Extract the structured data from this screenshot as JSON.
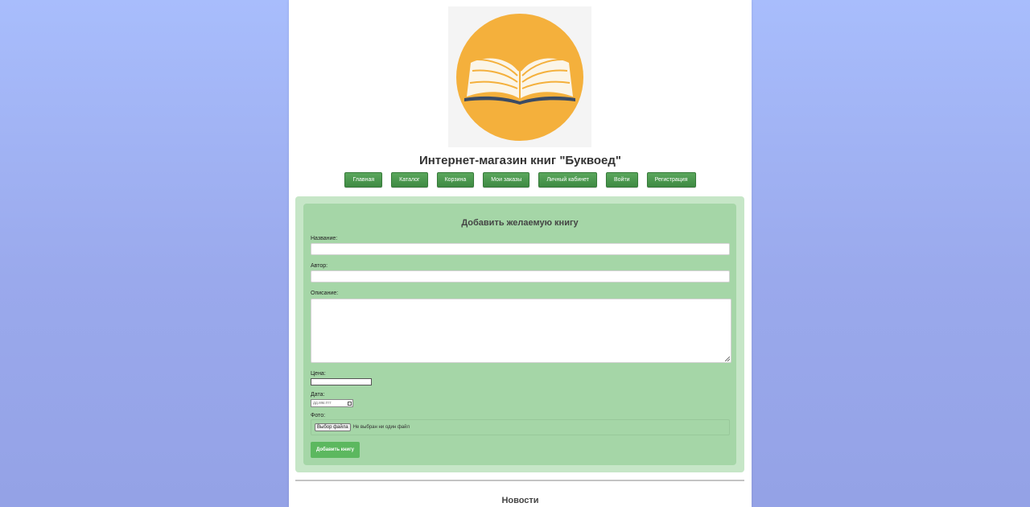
{
  "header": {
    "logo_icon": "open-book-logo",
    "logo_colors": {
      "circle": "#f4b03c",
      "book_cover": "#3b4b64",
      "pages": "#fbf5e8"
    },
    "title": "Интернет-магазин книг \"Буквоед\""
  },
  "nav": {
    "items": [
      {
        "label": "Главная"
      },
      {
        "label": "Каталог"
      },
      {
        "label": "Корзина"
      },
      {
        "label": "Мои заказы"
      },
      {
        "label": "Личный кабинет"
      },
      {
        "label": "Войти"
      },
      {
        "label": "Регистрация"
      }
    ]
  },
  "form": {
    "title": "Добавить желаемую книгу",
    "name_label": "Название:",
    "name_value": "",
    "author_label": "Автор:",
    "author_value": "",
    "description_label": "Описание:",
    "description_value": "",
    "price_label": "Цена:",
    "price_value": "",
    "date_label": "Дата:",
    "date_placeholder": "дд.мм.гггг",
    "photo_label": "Фото:",
    "file_button": "Выбор файла",
    "file_status": "Не выбран ни один файл",
    "submit_label": "Добавить книгу"
  },
  "news": {
    "title": "Новости"
  },
  "colors": {
    "nav_button": "#4a9a4e",
    "form_outer": "#c6e6c7",
    "form_inner": "#a5d6a7",
    "submit_button": "#5cb85f"
  }
}
